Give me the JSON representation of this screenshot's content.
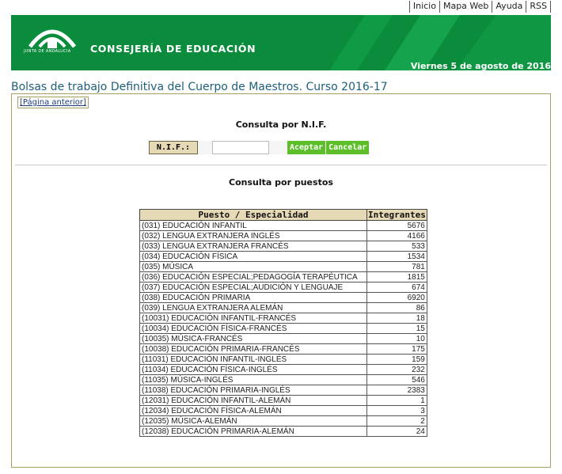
{
  "top_links": [
    "Inicio",
    "Mapa Web",
    "Ayuda",
    "RSS"
  ],
  "banner": {
    "logo_text": "JUNTA DE ANDALUCIA",
    "consejeria": "CONSEJERÍA DE EDUCACIÓN",
    "date": "Viernes 5 de agosto de 2016",
    "brand_color": "#0a8c3c"
  },
  "page_title": "Bolsas de trabajo Definitiva del Cuerpo de Maestros. Curso 2016-17",
  "prev_link": "[Página anterior]",
  "nif_section": {
    "title": "Consulta por N.I.F.",
    "label": "N.I.F.:",
    "input_value": "",
    "accept_label": "Aceptar",
    "cancel_label": "Cancelar"
  },
  "puestos_section": {
    "title": "Consulta por puestos",
    "headers": [
      "Puesto / Especialidad",
      "Integrantes"
    ],
    "rows": [
      {
        "name": "(031) EDUCACIÓN INFANTIL",
        "count": "5676"
      },
      {
        "name": "(032) LENGUA EXTRANJERA INGLÉS",
        "count": "4166"
      },
      {
        "name": "(033) LENGUA EXTRANJERA FRANCÉS",
        "count": "533"
      },
      {
        "name": "(034) EDUCACIÓN FÍSICA",
        "count": "1534"
      },
      {
        "name": "(035) MÚSICA",
        "count": "781"
      },
      {
        "name": "(036) EDUCACIÓN ESPECIAL;PEDAGOGÍA TERAPÉUTICA",
        "count": "1815"
      },
      {
        "name": "(037) EDUCACIÓN ESPECIAL;AUDICIÓN Y LENGUAJE",
        "count": "674"
      },
      {
        "name": "(038) EDUCACIÓN PRIMARIA",
        "count": "6920"
      },
      {
        "name": "(039) LENGUA EXTRANJERA ALEMÁN",
        "count": "86"
      },
      {
        "name": "(10031) EDUCACIÓN INFANTIL-FRANCÉS",
        "count": "18"
      },
      {
        "name": "(10034) EDUCACIÓN FÍSICA-FRANCÉS",
        "count": "15"
      },
      {
        "name": "(10035) MÚSICA-FRANCÉS",
        "count": "10"
      },
      {
        "name": "(10038) EDUCACIÓN PRIMARIA-FRANCÉS",
        "count": "175"
      },
      {
        "name": "(11031) EDUCACIÓN INFANTIL-INGLÉS",
        "count": "159"
      },
      {
        "name": "(11034) EDUCACIÓN FÍSICA-INGLÉS",
        "count": "232"
      },
      {
        "name": "(11035) MÚSICA-INGLÉS",
        "count": "546"
      },
      {
        "name": "(11038) EDUCACIÓN PRIMARIA-INGLÉS",
        "count": "2383"
      },
      {
        "name": "(12031) EDUCACIÓN INFANTIL-ALEMÁN",
        "count": "1"
      },
      {
        "name": "(12034) EDUCACIÓN FÍSICA-ALEMÁN",
        "count": "3"
      },
      {
        "name": "(12035) MÚSICA-ALEMÁN",
        "count": "2"
      },
      {
        "name": "(12038) EDUCACIÓN PRIMARIA-ALEMÁN",
        "count": "24"
      }
    ]
  }
}
